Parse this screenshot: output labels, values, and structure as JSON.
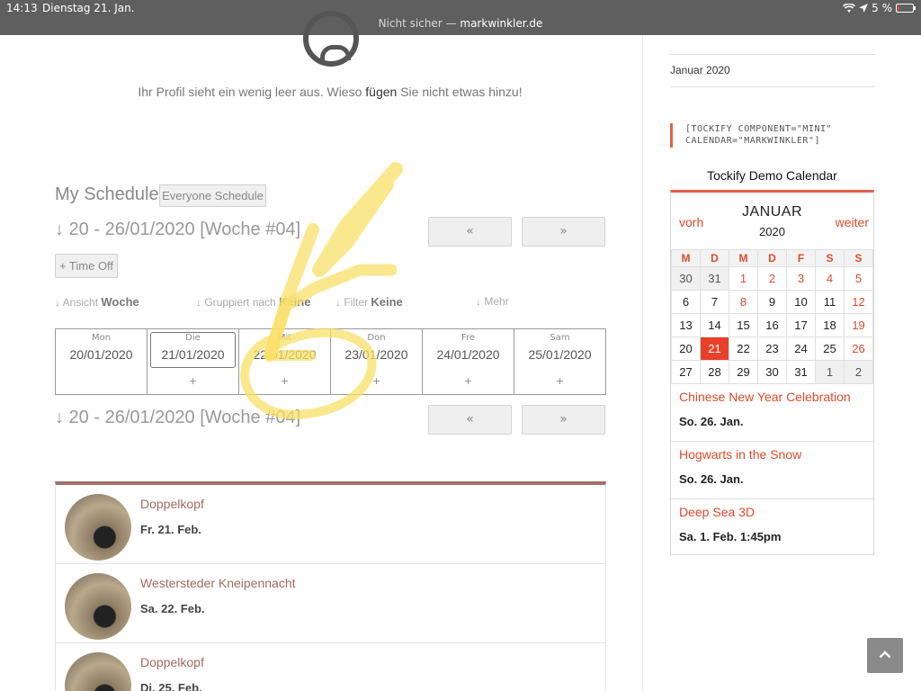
{
  "status_bar": {
    "time": "14:13",
    "date": "Dienstag 21. Jan.",
    "insecure_label": "Nicht sicher —",
    "domain": "markwinkler.de",
    "battery": "5 %"
  },
  "profile": {
    "empty_text_before": "Ihr Profil sieht ein wenig leer aus. Wieso",
    "empty_link": "fügen",
    "empty_text_after": "Sie nicht etwas hinzu!"
  },
  "schedule": {
    "title": "My Schedule",
    "everyone_button": "Everyone Schedule",
    "week_label": "↓ 20 - 26/01/2020 [Woche #04]",
    "prev_label": "«",
    "next_label": "»",
    "time_off_button": "+ Time Off",
    "view_label": "↓ Ansicht",
    "view_value": "Woche",
    "group_label": "↓ Gruppiert nach",
    "group_value": "Keine",
    "filter_label": "↓ Filter",
    "filter_value": "Keine",
    "more_label": "↓ Mehr",
    "days": [
      {
        "name": "Mon",
        "date": "20/01/2020",
        "plus": ""
      },
      {
        "name": "Die",
        "date": "21/01/2020",
        "plus": "+"
      },
      {
        "name": "Mit",
        "date": "22/01/2020",
        "plus": "+"
      },
      {
        "name": "Don",
        "date": "23/01/2020",
        "plus": "+"
      },
      {
        "name": "Fre",
        "date": "24/01/2020",
        "plus": "+"
      },
      {
        "name": "Sam",
        "date": "25/01/2020",
        "plus": "+"
      }
    ]
  },
  "events": [
    {
      "title": "Doppelkopf",
      "date": "Fr. 21. Feb."
    },
    {
      "title": "Westersteder Kneipennacht",
      "date": "Sa. 22. Feb."
    },
    {
      "title": "Doppelkopf",
      "date": "Di. 25. Feb."
    }
  ],
  "sidebar": {
    "archive": "Januar 2020",
    "shortcode_line1": "[TOCKIFY COMPONENT=\"MINI\"",
    "shortcode_line2": "CALENDAR=\"MARKWINKLER\"]",
    "calendar": {
      "title": "Tockify Demo Calendar",
      "prev": "vorh",
      "next": "weiter",
      "month": "JANUAR",
      "year": "2020",
      "weekdays": [
        "M",
        "D",
        "M",
        "D",
        "F",
        "S",
        "S"
      ],
      "weeks": [
        [
          "30",
          "31",
          "1",
          "2",
          "3",
          "4",
          "5"
        ],
        [
          "6",
          "7",
          "8",
          "9",
          "10",
          "11",
          "12"
        ],
        [
          "13",
          "14",
          "15",
          "16",
          "17",
          "18",
          "19"
        ],
        [
          "20",
          "21",
          "22",
          "23",
          "24",
          "25",
          "26"
        ],
        [
          "27",
          "28",
          "29",
          "30",
          "31",
          "1",
          "2"
        ]
      ],
      "events": [
        {
          "title": "Chinese New Year Celebration",
          "date": "So. 26. Jan."
        },
        {
          "title": "Hogwarts in the Snow",
          "date": "So. 26. Jan."
        },
        {
          "title": "Deep Sea 3D",
          "date": "Sa. 1. Feb. 1:45pm"
        }
      ]
    }
  },
  "colors": {
    "accent_red": "#e04a2a",
    "event_title": "#a06a62",
    "highlighter": "#f8e06a"
  },
  "icons": {
    "scroll_top": "chevron-up-icon",
    "sad_face": "sad-face-icon"
  }
}
